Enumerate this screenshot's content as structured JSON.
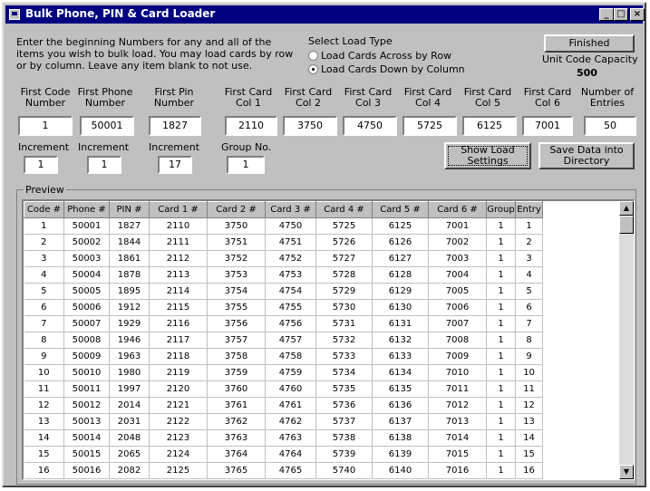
{
  "window": {
    "title": "Bulk Phone, PIN & Card Loader",
    "min_glyph": "_",
    "max_glyph": "□",
    "close_glyph": "×"
  },
  "instructions": "Enter the beginning Numbers for any and all of the items you wish to bulk load. You may load cards by row or by column. Leave any item blank to not use.",
  "load_type": {
    "heading": "Select Load Type",
    "option_row": "Load Cards Across by Row",
    "option_column": "Load Cards Down by Column",
    "selected": "column"
  },
  "finished_button": "Finished",
  "capacity": {
    "label": "Unit Code Capacity",
    "value": "500"
  },
  "fields": {
    "first_code": {
      "label": "First Code Number",
      "value": "1"
    },
    "first_phone": {
      "label": "First Phone Number",
      "value": "50001"
    },
    "first_pin": {
      "label": "First Pin Number",
      "value": "1827"
    },
    "card1": {
      "label": "First Card Col 1",
      "value": "2110"
    },
    "card2": {
      "label": "First Card Col 2",
      "value": "3750"
    },
    "card3": {
      "label": "First Card Col 3",
      "value": "4750"
    },
    "card4": {
      "label": "First Card Col 4",
      "value": "5725"
    },
    "card5": {
      "label": "First Card Col 5",
      "value": "6125"
    },
    "card6": {
      "label": "First Card Col 6",
      "value": "7001"
    },
    "entries": {
      "label": "Number of Entries",
      "value": "50"
    }
  },
  "increments": {
    "code": {
      "label": "Increment",
      "value": "1"
    },
    "phone": {
      "label": "Increment",
      "value": "1"
    },
    "pin": {
      "label": "Increment",
      "value": "17"
    },
    "group": {
      "label": "Group No.",
      "value": "1"
    }
  },
  "buttons": {
    "show_load": "Show Load Settings",
    "save_data": "Save Data into Directory"
  },
  "preview": {
    "label": "Preview",
    "columns": [
      "Code #",
      "Phone #",
      "PIN #",
      "Card 1 #",
      "Card 2 #",
      "Card 3 #",
      "Card 4 #",
      "Card 5 #",
      "Card 6 #",
      "Group",
      "Entry"
    ],
    "rows": [
      [
        "1",
        "50001",
        "1827",
        "2110",
        "3750",
        "4750",
        "5725",
        "6125",
        "7001",
        "1",
        "1"
      ],
      [
        "2",
        "50002",
        "1844",
        "2111",
        "3751",
        "4751",
        "5726",
        "6126",
        "7002",
        "1",
        "2"
      ],
      [
        "3",
        "50003",
        "1861",
        "2112",
        "3752",
        "4752",
        "5727",
        "6127",
        "7003",
        "1",
        "3"
      ],
      [
        "4",
        "50004",
        "1878",
        "2113",
        "3753",
        "4753",
        "5728",
        "6128",
        "7004",
        "1",
        "4"
      ],
      [
        "5",
        "50005",
        "1895",
        "2114",
        "3754",
        "4754",
        "5729",
        "6129",
        "7005",
        "1",
        "5"
      ],
      [
        "6",
        "50006",
        "1912",
        "2115",
        "3755",
        "4755",
        "5730",
        "6130",
        "7006",
        "1",
        "6"
      ],
      [
        "7",
        "50007",
        "1929",
        "2116",
        "3756",
        "4756",
        "5731",
        "6131",
        "7007",
        "1",
        "7"
      ],
      [
        "8",
        "50008",
        "1946",
        "2117",
        "3757",
        "4757",
        "5732",
        "6132",
        "7008",
        "1",
        "8"
      ],
      [
        "9",
        "50009",
        "1963",
        "2118",
        "3758",
        "4758",
        "5733",
        "6133",
        "7009",
        "1",
        "9"
      ],
      [
        "10",
        "50010",
        "1980",
        "2119",
        "3759",
        "4759",
        "5734",
        "6134",
        "7010",
        "1",
        "10"
      ],
      [
        "11",
        "50011",
        "1997",
        "2120",
        "3760",
        "4760",
        "5735",
        "6135",
        "7011",
        "1",
        "11"
      ],
      [
        "12",
        "50012",
        "2014",
        "2121",
        "3761",
        "4761",
        "5736",
        "6136",
        "7012",
        "1",
        "12"
      ],
      [
        "13",
        "50013",
        "2031",
        "2122",
        "3762",
        "4762",
        "5737",
        "6137",
        "7013",
        "1",
        "13"
      ],
      [
        "14",
        "50014",
        "2048",
        "2123",
        "3763",
        "4763",
        "5738",
        "6138",
        "7014",
        "1",
        "14"
      ],
      [
        "15",
        "50015",
        "2065",
        "2124",
        "3764",
        "4764",
        "5739",
        "6139",
        "7015",
        "1",
        "15"
      ],
      [
        "16",
        "50016",
        "2082",
        "2125",
        "3765",
        "4765",
        "5740",
        "6140",
        "7016",
        "1",
        "16"
      ]
    ]
  },
  "scroll_icons": {
    "up": "▲",
    "down": "▼"
  }
}
